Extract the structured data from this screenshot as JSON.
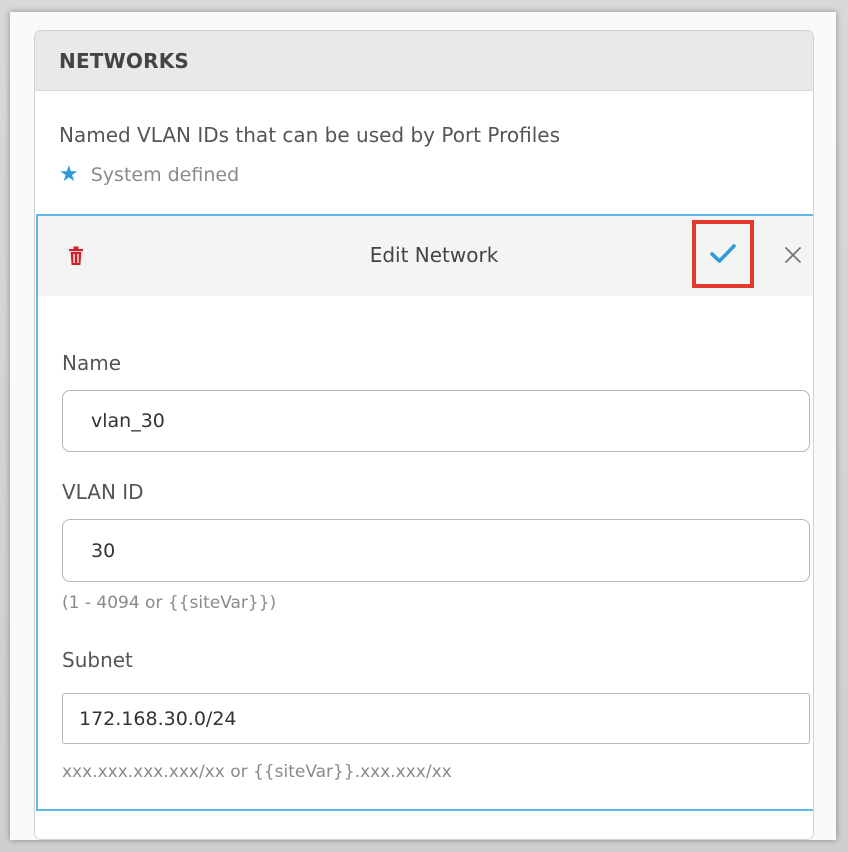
{
  "card": {
    "title": "NETWORKS",
    "description": "Named VLAN IDs that can be used by Port Profiles",
    "system_defined": "System defined"
  },
  "edit": {
    "title": "Edit Network",
    "icons": {
      "delete": "trash-icon",
      "save": "check-icon",
      "close": "close-icon"
    },
    "colors": {
      "delete": "#d0202a",
      "check": "#2e9ad8",
      "highlight": "#e03a2a",
      "border": "#5fb9e8"
    }
  },
  "fields": {
    "name": {
      "label": "Name",
      "value": "vlan_30"
    },
    "vlan": {
      "label": "VLAN ID",
      "value": "30",
      "hint": "(1 - 4094 or {{siteVar}})"
    },
    "subnet": {
      "label": "Subnet",
      "value": "172.168.30.0/24",
      "hint": "xxx.xxx.xxx.xxx/xx or {{siteVar}}.xxx.xxx/xx"
    }
  }
}
